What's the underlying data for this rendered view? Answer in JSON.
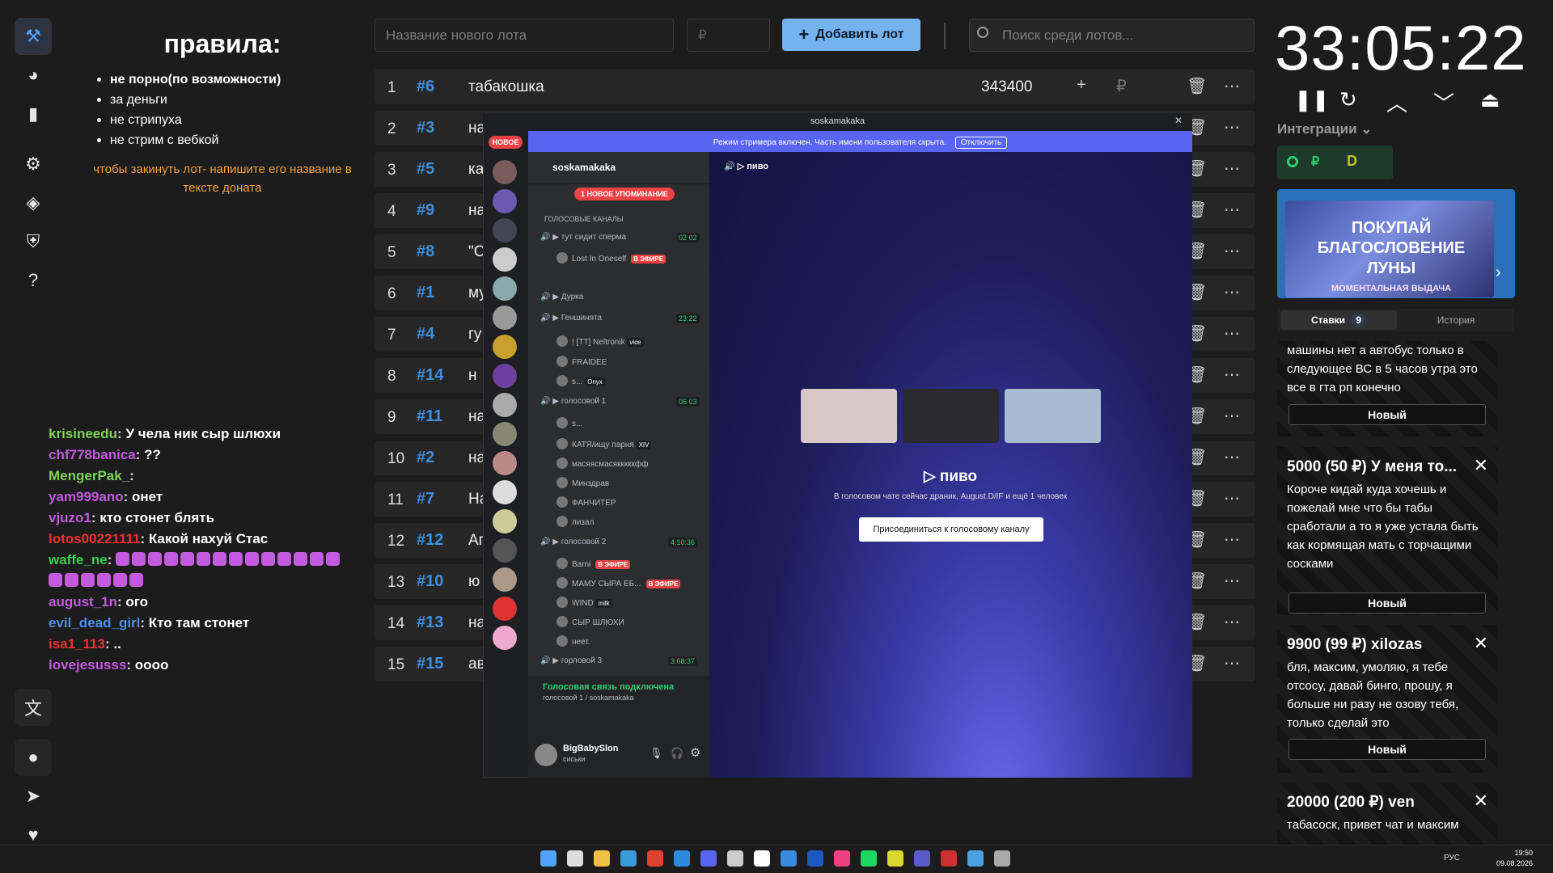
{
  "rules": {
    "title": "правила:",
    "items": [
      "не порно(по возможности)",
      "за деньги",
      "не стрипуха",
      "не стрим с вебкой"
    ],
    "note": "чтобы закинуть лот- напишите его название в тексте доната"
  },
  "chat": [
    {
      "user": "krisineedu",
      "color": "#7dd35a",
      "msg": "У чела ник сыр шлюхи"
    },
    {
      "user": "chf778banica",
      "color": "#c25ae0",
      "msg": "??"
    },
    {
      "user": "MengerPak_",
      "color": "#7dd35a",
      "msg": ""
    },
    {
      "user": "yam999ano",
      "color": "#c25ae0",
      "msg": "онет"
    },
    {
      "user": "vjuzo1",
      "color": "#c25ae0",
      "msg": "кто стонет блять"
    },
    {
      "user": "lotos00221111",
      "color": "#ee3030",
      "msg": "Какой нахуй Стас"
    },
    {
      "user": "waffe_ne",
      "color": "#35d050",
      "msg": ""
    },
    {
      "user": "august_1n",
      "color": "#c25ae0",
      "msg": "ого"
    },
    {
      "user": "evil_dead_girl",
      "color": "#4d8fe8",
      "msg": "Кто там стонет"
    },
    {
      "user": "isa1_113",
      "color": "#ee3030",
      "msg": ".."
    },
    {
      "user": "lovejesusss",
      "color": "#c25ae0",
      "msg": "оооо"
    }
  ],
  "topbar": {
    "name_placeholder": "Название нового лота",
    "price_placeholder": "₽",
    "add_label": "Добавить лот",
    "search_placeholder": "Поиск среди лотов..."
  },
  "lots": [
    {
      "n": "1",
      "id": "#6",
      "name": "табакошка",
      "amount": "343400"
    },
    {
      "n": "2",
      "id": "#3",
      "name": "на"
    },
    {
      "n": "3",
      "id": "#5",
      "name": "ка"
    },
    {
      "n": "4",
      "id": "#9",
      "name": "на"
    },
    {
      "n": "5",
      "id": "#8",
      "name": "\"С"
    },
    {
      "n": "6",
      "id": "#1",
      "name": "му"
    },
    {
      "n": "7",
      "id": "#4",
      "name": "гу"
    },
    {
      "n": "8",
      "id": "#14",
      "name": "н"
    },
    {
      "n": "9",
      "id": "#11",
      "name": "на"
    },
    {
      "n": "10",
      "id": "#2",
      "name": "на"
    },
    {
      "n": "11",
      "id": "#7",
      "name": "На"
    },
    {
      "n": "12",
      "id": "#12",
      "name": "Аг"
    },
    {
      "n": "13",
      "id": "#10",
      "name": "ю"
    },
    {
      "n": "14",
      "id": "#13",
      "name": "на"
    },
    {
      "n": "15",
      "id": "#15",
      "name": "ав"
    }
  ],
  "timer": {
    "value": "33:05:22"
  },
  "integrations": {
    "label": "Интеграции"
  },
  "promo": {
    "text": "ПОКУПАЙ БЛАГОСЛОВЕНИЕ ЛУНЫ",
    "sub": "МОМЕНТАЛЬНАЯ ВЫДАЧА"
  },
  "bids_tabs": {
    "bids": "Ставки",
    "bids_count": "9",
    "history": "История"
  },
  "bids": [
    {
      "header": "",
      "text": "машины нет а автобус только в следующее ВС в 5 часов утра это все в гта рп конечно",
      "status": "Новый"
    },
    {
      "header": "5000 (50 ₽) У меня то...",
      "text": "Короче кидай куда хочешь и пожелай мне что бы табы сработали а то я уже устала быть как кормящая мать с торчащими сосками",
      "status": "Новый"
    },
    {
      "header": "9900 (99 ₽) xilozas",
      "text": "бля, максим, умоляю, я тебе отсосу, давай бинго, прошу, я больше ни разу не озову тебя, только сделай это",
      "status": "Новый"
    },
    {
      "header": "20000 (200 ₽) ven",
      "text": "табасоск, привет чат и максим"
    }
  ],
  "discord": {
    "window_title": "soskamakaka",
    "banner": "Режим стримера включен. Часть имени пользователя скрыта.",
    "banner_btn": "Отключить",
    "new_badge": "НОВОЕ",
    "server_name": "soskamakaka",
    "mention": "1 НОВОЕ УПОМИНАНИЕ",
    "category": "ГОЛОСОВЫЕ КАНАЛЫ",
    "channels": [
      {
        "name": "тут сидит сперма",
        "count": "02  02"
      },
      {
        "name": "Lost In Oneself",
        "live": "В ЭФИРЕ"
      },
      {
        "name": "Дурка"
      },
      {
        "name": "Геншинята",
        "count": "23:22"
      },
      {
        "name": "! [TT] Neltronik",
        "tag": "vice"
      },
      {
        "name": "FRAIDEE"
      },
      {
        "name": "s...",
        "tag": "Onyx"
      },
      {
        "name": "голосовой 1",
        "count": "06  03"
      },
      {
        "name": "s..."
      },
      {
        "name": "КАТЯ/ищу парня",
        "tag": "XIV"
      },
      {
        "name": "масяясмасякккккфф"
      },
      {
        "name": "Минздрав"
      },
      {
        "name": "ФАНЧИТЕР"
      },
      {
        "name": "лизал"
      },
      {
        "name": "голосовой 2",
        "count": "4:10:36"
      },
      {
        "name": "Barni",
        "live": "В ЭФИРЕ"
      },
      {
        "name": "МАМУ СЫРА ЕБ...",
        "live": "В ЭФИРЕ"
      },
      {
        "name": "WIND",
        "tag": "milk"
      },
      {
        "name": "СЫР ШЛЮХИ"
      },
      {
        "name": "неет."
      },
      {
        "name": "горловой 3",
        "count": "3:08:37"
      }
    ],
    "voice_status": "Голосовая связь подключена",
    "voice_sub": "голосовой 1 / soskamakaka",
    "user_name": "BigBabySlon",
    "user_status": "сиськи",
    "main_channel": "пиво",
    "main_title": "пиво",
    "main_sub": "В голосовом чате сейчас драник, August.D/IF и ещё 1 человек",
    "join_btn": "Присоединиться к голосовому каналу"
  },
  "taskbar": {
    "lang": "РУС",
    "time": "19:50",
    "date": "09.08.2026"
  }
}
